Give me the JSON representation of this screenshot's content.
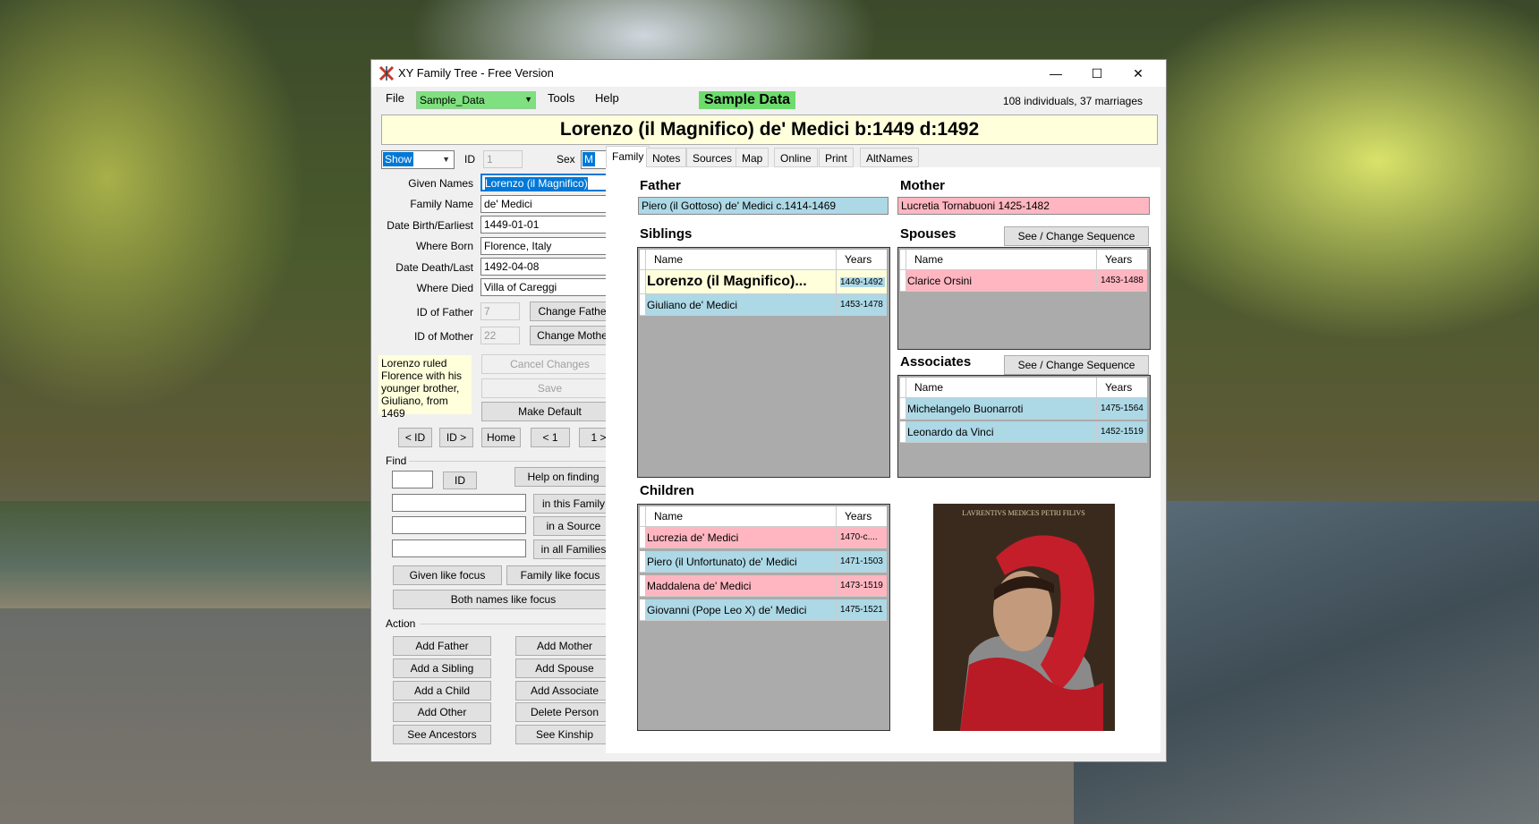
{
  "window": {
    "title": "XY Family Tree - Free Version",
    "minimize": "—",
    "maximize": "☐",
    "close": "✕"
  },
  "menu": {
    "file": "File",
    "database": "Sample_Data",
    "tools": "Tools",
    "help": "Help",
    "badge": "Sample Data",
    "counts": "108 individuals, 37 marriages"
  },
  "person_title": "Lorenzo (il Magnifico) de' Medici  b:1449 d:1492",
  "form": {
    "show": "Show",
    "id_label": "ID",
    "id_value": "1",
    "sex_label": "Sex",
    "sex_value": "M",
    "given_names_label": "Given Names",
    "given_names": "Lorenzo (il Magnifico)",
    "family_name_label": "Family Name",
    "family_name": "de' Medici",
    "date_birth_label": "Date Birth/Earliest",
    "date_birth": "1449-01-01",
    "where_born_label": "Where Born",
    "where_born": "Florence, Italy",
    "date_death_label": "Date Death/Last",
    "date_death": "1492-04-08",
    "where_died_label": "Where Died",
    "where_died": "Villa of Careggi",
    "id_father_label": "ID of Father",
    "id_father": "7",
    "change_father": "Change Father",
    "id_mother_label": "ID of Mother",
    "id_mother": "22",
    "change_mother": "Change Mother",
    "note": "Lorenzo ruled Florence with his younger brother, Giuliano, from 1469",
    "cancel_changes": "Cancel Changes",
    "save": "Save",
    "make_default": "Make Default"
  },
  "nav": {
    "prev_id": "< ID",
    "next_id": "ID >",
    "home": "Home",
    "prev_1": "< 1",
    "next_1": "1 >"
  },
  "find": {
    "label": "Find",
    "id_btn": "ID",
    "help": "Help on finding",
    "in_family": "in this Family",
    "in_source": "in a Source",
    "in_all": "in all Families",
    "given_like": "Given like focus",
    "family_like": "Family like focus",
    "both_like": "Both names like focus"
  },
  "action": {
    "label": "Action",
    "add_father": "Add Father",
    "add_mother": "Add Mother",
    "add_sibling": "Add a Sibling",
    "add_spouse": "Add Spouse",
    "add_child": "Add a Child",
    "add_associate": "Add Associate",
    "add_other": "Add Other",
    "delete_person": "Delete Person",
    "see_ancestors": "See Ancestors",
    "see_kinship": "See Kinship"
  },
  "tabs": [
    "Family",
    "Notes",
    "Sources",
    "Map",
    "Online",
    "Print",
    "AltNames"
  ],
  "family": {
    "father_label": "Father",
    "father": "Piero (il Gottoso) de' Medici c.1414-1469",
    "mother_label": "Mother",
    "mother": "Lucretia Tornabuoni 1425-1482",
    "siblings_label": "Siblings",
    "spouses_label": "Spouses",
    "associates_label": "Associates",
    "children_label": "Children",
    "see_change_seq": "See / Change Sequence",
    "col_name": "Name",
    "col_years": "Years",
    "siblings": [
      {
        "name": "Lorenzo (il Magnifico)...",
        "years": "1449-1492"
      },
      {
        "name": "Giuliano de' Medici",
        "years": "1453-1478"
      }
    ],
    "spouses": [
      {
        "name": "Clarice Orsini",
        "years": "1453-1488"
      }
    ],
    "associates": [
      {
        "name": "Michelangelo Buonarroti",
        "years": "1475-1564"
      },
      {
        "name": "Leonardo da Vinci",
        "years": "1452-1519"
      }
    ],
    "children": [
      {
        "name": "Lucrezia de' Medici",
        "years": "1470-c...."
      },
      {
        "name": "Piero (il Unfortunato) de' Medici",
        "years": "1471-1503"
      },
      {
        "name": "Maddalena de' Medici",
        "years": "1473-1519"
      },
      {
        "name": "Giovanni (Pope Leo X) de' Medici",
        "years": "1475-1521"
      }
    ],
    "portrait_caption": "LAVRENTIVS MEDICES PETRI FILIVS"
  }
}
